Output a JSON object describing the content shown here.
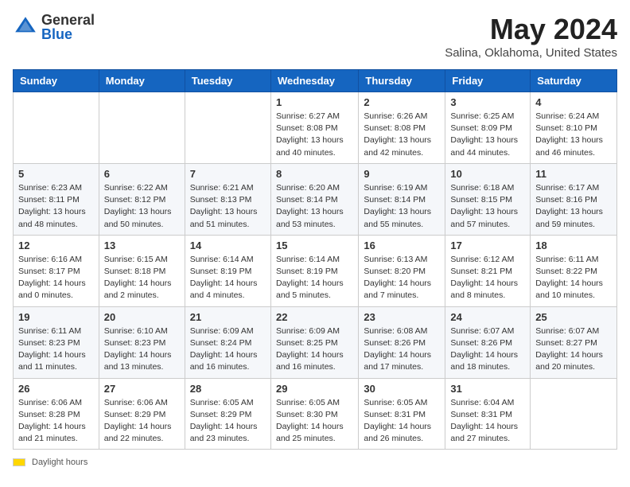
{
  "header": {
    "logo_general": "General",
    "logo_blue": "Blue",
    "title": "May 2024",
    "subtitle": "Salina, Oklahoma, United States"
  },
  "days_of_week": [
    "Sunday",
    "Monday",
    "Tuesday",
    "Wednesday",
    "Thursday",
    "Friday",
    "Saturday"
  ],
  "footer": {
    "label": "Daylight hours"
  },
  "weeks": [
    [
      {
        "num": "",
        "sunrise": "",
        "sunset": "",
        "daylight": ""
      },
      {
        "num": "",
        "sunrise": "",
        "sunset": "",
        "daylight": ""
      },
      {
        "num": "",
        "sunrise": "",
        "sunset": "",
        "daylight": ""
      },
      {
        "num": "1",
        "sunrise": "Sunrise: 6:27 AM",
        "sunset": "Sunset: 8:08 PM",
        "daylight": "Daylight: 13 hours and 40 minutes."
      },
      {
        "num": "2",
        "sunrise": "Sunrise: 6:26 AM",
        "sunset": "Sunset: 8:08 PM",
        "daylight": "Daylight: 13 hours and 42 minutes."
      },
      {
        "num": "3",
        "sunrise": "Sunrise: 6:25 AM",
        "sunset": "Sunset: 8:09 PM",
        "daylight": "Daylight: 13 hours and 44 minutes."
      },
      {
        "num": "4",
        "sunrise": "Sunrise: 6:24 AM",
        "sunset": "Sunset: 8:10 PM",
        "daylight": "Daylight: 13 hours and 46 minutes."
      }
    ],
    [
      {
        "num": "5",
        "sunrise": "Sunrise: 6:23 AM",
        "sunset": "Sunset: 8:11 PM",
        "daylight": "Daylight: 13 hours and 48 minutes."
      },
      {
        "num": "6",
        "sunrise": "Sunrise: 6:22 AM",
        "sunset": "Sunset: 8:12 PM",
        "daylight": "Daylight: 13 hours and 50 minutes."
      },
      {
        "num": "7",
        "sunrise": "Sunrise: 6:21 AM",
        "sunset": "Sunset: 8:13 PM",
        "daylight": "Daylight: 13 hours and 51 minutes."
      },
      {
        "num": "8",
        "sunrise": "Sunrise: 6:20 AM",
        "sunset": "Sunset: 8:14 PM",
        "daylight": "Daylight: 13 hours and 53 minutes."
      },
      {
        "num": "9",
        "sunrise": "Sunrise: 6:19 AM",
        "sunset": "Sunset: 8:14 PM",
        "daylight": "Daylight: 13 hours and 55 minutes."
      },
      {
        "num": "10",
        "sunrise": "Sunrise: 6:18 AM",
        "sunset": "Sunset: 8:15 PM",
        "daylight": "Daylight: 13 hours and 57 minutes."
      },
      {
        "num": "11",
        "sunrise": "Sunrise: 6:17 AM",
        "sunset": "Sunset: 8:16 PM",
        "daylight": "Daylight: 13 hours and 59 minutes."
      }
    ],
    [
      {
        "num": "12",
        "sunrise": "Sunrise: 6:16 AM",
        "sunset": "Sunset: 8:17 PM",
        "daylight": "Daylight: 14 hours and 0 minutes."
      },
      {
        "num": "13",
        "sunrise": "Sunrise: 6:15 AM",
        "sunset": "Sunset: 8:18 PM",
        "daylight": "Daylight: 14 hours and 2 minutes."
      },
      {
        "num": "14",
        "sunrise": "Sunrise: 6:14 AM",
        "sunset": "Sunset: 8:19 PM",
        "daylight": "Daylight: 14 hours and 4 minutes."
      },
      {
        "num": "15",
        "sunrise": "Sunrise: 6:14 AM",
        "sunset": "Sunset: 8:19 PM",
        "daylight": "Daylight: 14 hours and 5 minutes."
      },
      {
        "num": "16",
        "sunrise": "Sunrise: 6:13 AM",
        "sunset": "Sunset: 8:20 PM",
        "daylight": "Daylight: 14 hours and 7 minutes."
      },
      {
        "num": "17",
        "sunrise": "Sunrise: 6:12 AM",
        "sunset": "Sunset: 8:21 PM",
        "daylight": "Daylight: 14 hours and 8 minutes."
      },
      {
        "num": "18",
        "sunrise": "Sunrise: 6:11 AM",
        "sunset": "Sunset: 8:22 PM",
        "daylight": "Daylight: 14 hours and 10 minutes."
      }
    ],
    [
      {
        "num": "19",
        "sunrise": "Sunrise: 6:11 AM",
        "sunset": "Sunset: 8:23 PM",
        "daylight": "Daylight: 14 hours and 11 minutes."
      },
      {
        "num": "20",
        "sunrise": "Sunrise: 6:10 AM",
        "sunset": "Sunset: 8:23 PM",
        "daylight": "Daylight: 14 hours and 13 minutes."
      },
      {
        "num": "21",
        "sunrise": "Sunrise: 6:09 AM",
        "sunset": "Sunset: 8:24 PM",
        "daylight": "Daylight: 14 hours and 16 minutes."
      },
      {
        "num": "22",
        "sunrise": "Sunrise: 6:09 AM",
        "sunset": "Sunset: 8:25 PM",
        "daylight": "Daylight: 14 hours and 16 minutes."
      },
      {
        "num": "23",
        "sunrise": "Sunrise: 6:08 AM",
        "sunset": "Sunset: 8:26 PM",
        "daylight": "Daylight: 14 hours and 17 minutes."
      },
      {
        "num": "24",
        "sunrise": "Sunrise: 6:07 AM",
        "sunset": "Sunset: 8:26 PM",
        "daylight": "Daylight: 14 hours and 18 minutes."
      },
      {
        "num": "25",
        "sunrise": "Sunrise: 6:07 AM",
        "sunset": "Sunset: 8:27 PM",
        "daylight": "Daylight: 14 hours and 20 minutes."
      }
    ],
    [
      {
        "num": "26",
        "sunrise": "Sunrise: 6:06 AM",
        "sunset": "Sunset: 8:28 PM",
        "daylight": "Daylight: 14 hours and 21 minutes."
      },
      {
        "num": "27",
        "sunrise": "Sunrise: 6:06 AM",
        "sunset": "Sunset: 8:29 PM",
        "daylight": "Daylight: 14 hours and 22 minutes."
      },
      {
        "num": "28",
        "sunrise": "Sunrise: 6:05 AM",
        "sunset": "Sunset: 8:29 PM",
        "daylight": "Daylight: 14 hours and 23 minutes."
      },
      {
        "num": "29",
        "sunrise": "Sunrise: 6:05 AM",
        "sunset": "Sunset: 8:30 PM",
        "daylight": "Daylight: 14 hours and 25 minutes."
      },
      {
        "num": "30",
        "sunrise": "Sunrise: 6:05 AM",
        "sunset": "Sunset: 8:31 PM",
        "daylight": "Daylight: 14 hours and 26 minutes."
      },
      {
        "num": "31",
        "sunrise": "Sunrise: 6:04 AM",
        "sunset": "Sunset: 8:31 PM",
        "daylight": "Daylight: 14 hours and 27 minutes."
      },
      {
        "num": "",
        "sunrise": "",
        "sunset": "",
        "daylight": ""
      }
    ]
  ]
}
